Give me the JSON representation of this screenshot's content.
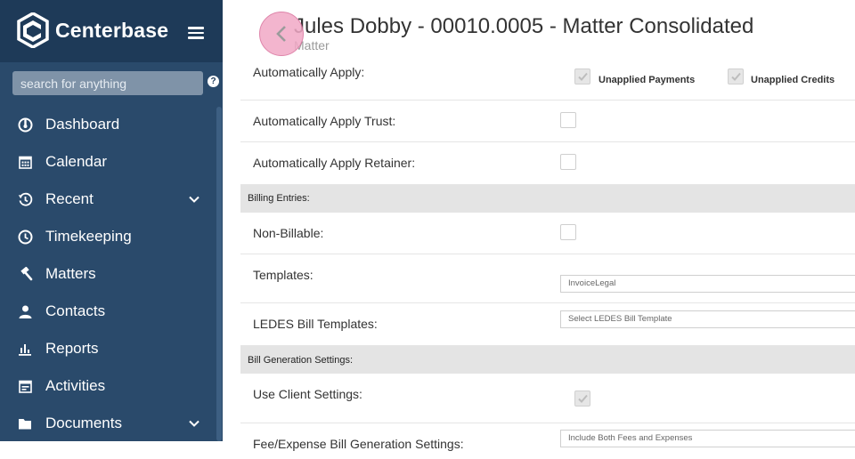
{
  "sidebar": {
    "brand": "Centerbase",
    "search_placeholder": "search for anything",
    "help_label": "?",
    "items": [
      {
        "label": "Dashboard",
        "icon": "dashboard-icon"
      },
      {
        "label": "Calendar",
        "icon": "calendar-icon"
      },
      {
        "label": "Recent",
        "icon": "history-icon",
        "expandable": true
      },
      {
        "label": "Timekeeping",
        "icon": "clock-icon"
      },
      {
        "label": "Matters",
        "icon": "gavel-icon"
      },
      {
        "label": "Contacts",
        "icon": "user-icon"
      },
      {
        "label": "Reports",
        "icon": "bar-chart-icon"
      },
      {
        "label": "Activities",
        "icon": "activities-icon"
      },
      {
        "label": "Documents",
        "icon": "folder-icon",
        "expandable": true
      }
    ]
  },
  "header": {
    "title": "Jules Dobby - 00010.0005 - Matter Consolidated",
    "subtitle": "Matter"
  },
  "form": {
    "auto_apply_label": "Automatically Apply:",
    "unapplied_payments_label": "Unapplied Payments",
    "unapplied_payments_checked": true,
    "unapplied_credits_label": "Unapplied Credits",
    "unapplied_credits_checked": true,
    "auto_apply_trust_label": "Automatically Apply Trust:",
    "auto_apply_trust_checked": false,
    "auto_apply_retainer_label": "Automatically Apply Retainer:",
    "auto_apply_retainer_checked": false,
    "billing_entries_section": "Billing Entries:",
    "non_billable_label": "Non-Billable:",
    "non_billable_checked": false,
    "templates_label": "Templates:",
    "templates_value": "InvoiceLegal",
    "ledes_label": "LEDES Bill Templates:",
    "ledes_placeholder": "Select LEDES Bill Template",
    "bill_generation_section": "Bill Generation Settings:",
    "use_client_settings_label": "Use Client Settings:",
    "use_client_settings_checked": true,
    "fee_expense_label": "Fee/Expense Bill Generation Settings:",
    "fee_expense_value": "Include Both Fees and Expenses"
  },
  "colors": {
    "sidebar_bg": "#2a4a6b",
    "sidebar_header_bg": "#1e3a58",
    "section_bg": "#e4e4e4",
    "back_button": "#f2a9c6"
  }
}
